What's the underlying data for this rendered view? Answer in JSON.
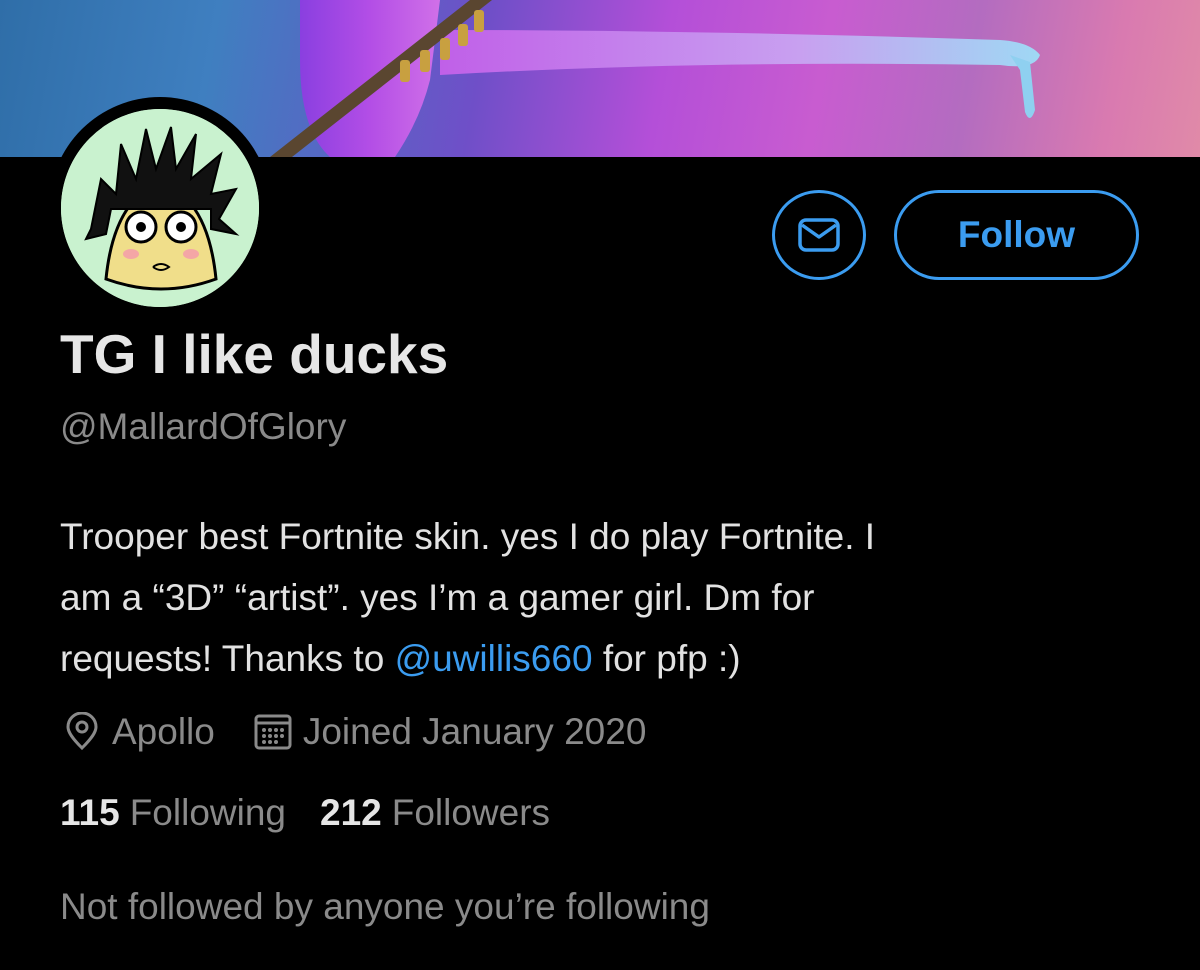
{
  "profile": {
    "display_name": "TG I like ducks",
    "handle": "@MallardOfGlory",
    "bio": {
      "line1": "Trooper best Fortnite skin. yes I do play Fortnite. I",
      "line2": "am a “3D” “artist”. yes I’m a gamer girl. Dm for",
      "line3_before": "requests! Thanks to ",
      "line3_mention": "@uwillis660",
      "line3_after": " for pfp :)"
    },
    "location": "Apollo",
    "joined": "Joined January 2020"
  },
  "actions": {
    "follow_label": "Follow",
    "message_icon": "mail-icon"
  },
  "stats": {
    "following_count": "115",
    "following_label": "Following",
    "followers_count": "212",
    "followers_label": "Followers"
  },
  "social_context": "Not followed by anyone you’re following",
  "colors": {
    "accent": "#3b9cf0",
    "background": "#000000",
    "secondary_text": "#8a8a8a"
  }
}
